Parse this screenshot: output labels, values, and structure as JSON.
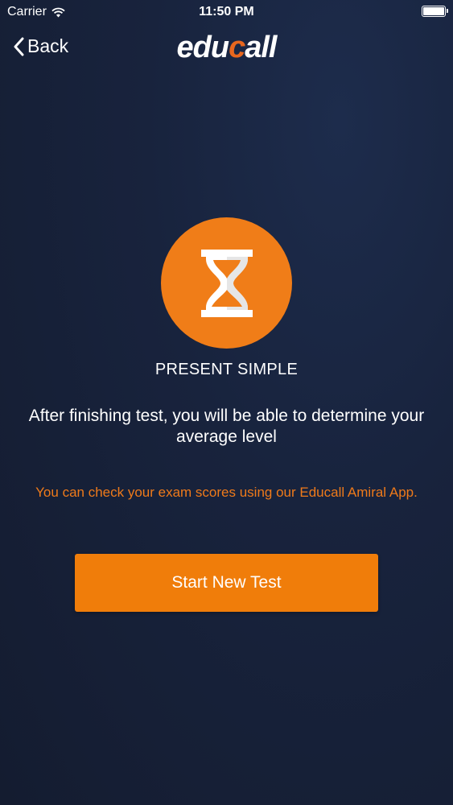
{
  "status_bar": {
    "carrier": "Carrier",
    "time": "11:50 PM"
  },
  "nav": {
    "back_label": "Back",
    "logo_part1": "edu",
    "logo_part2": "c",
    "logo_part3": "all"
  },
  "test": {
    "icon": "hourglass-icon",
    "title": "PRESENT SIMPLE",
    "description": "After finishing test, you will be able to determine your average level",
    "note": "You can check your exam scores using our Educall Amiral App.",
    "start_label": "Start New Test"
  },
  "colors": {
    "accent": "#f07d0a",
    "background": "#18233d",
    "note_text": "#ef7a1a"
  }
}
